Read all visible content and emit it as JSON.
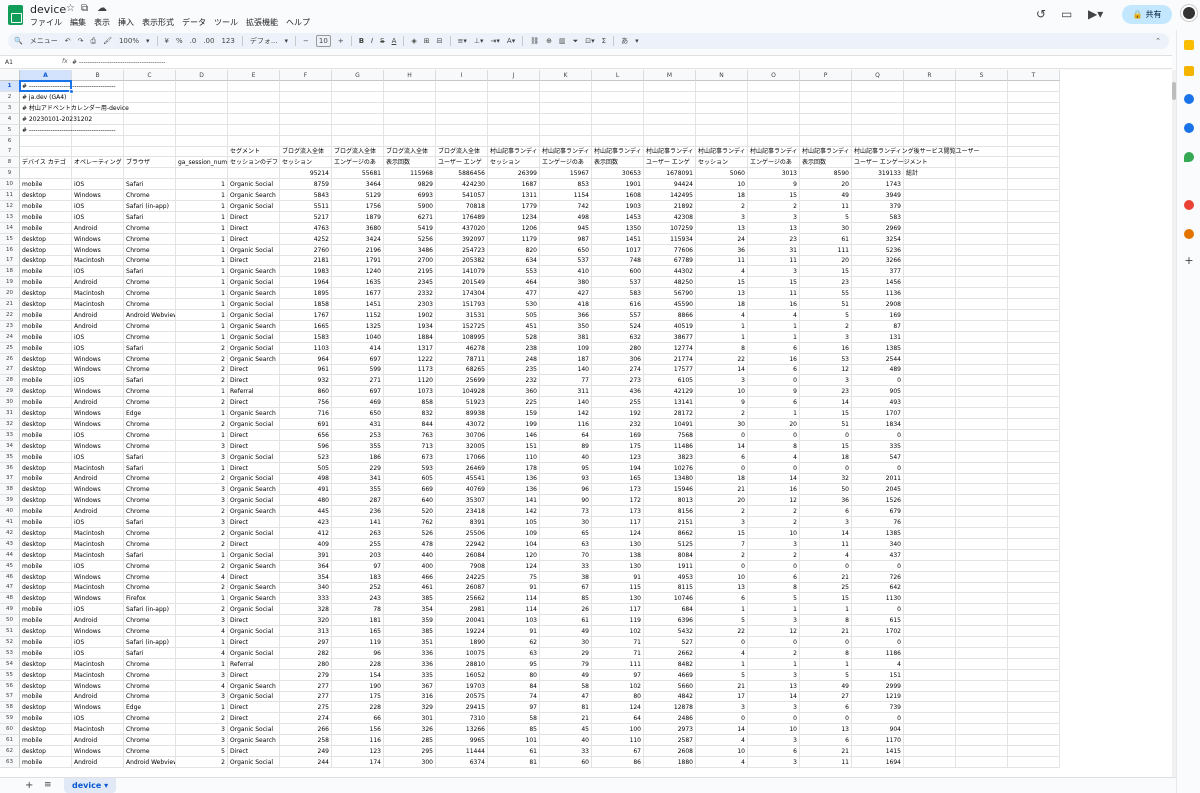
{
  "app": {
    "title": "device",
    "menu": [
      "ファイル",
      "編集",
      "表示",
      "挿入",
      "表示形式",
      "データ",
      "ツール",
      "拡張機能",
      "ヘルプ"
    ],
    "share_label": "共有",
    "icons": {
      "star": "star-icon",
      "folder": "move-to-folder-icon",
      "cloud": "cloud-status-icon",
      "history": "version-history-icon",
      "comment": "comment-icon",
      "meet": "video-call-icon",
      "lock": "lock-icon"
    }
  },
  "toolbar": {
    "menu_search": "メニュー",
    "zoom": "100%",
    "currency": "¥",
    "percent": "%",
    "dec_decrease": ".0",
    "dec_increase": ".00",
    "format_123": "123",
    "font": "デフォ...",
    "font_size": "10",
    "bold": "B",
    "italic": "I",
    "strike": "S",
    "text_color": "A",
    "sum": "Σ",
    "input_tools": "あ"
  },
  "formula_bar": {
    "name_box": "A1",
    "fx": "fx",
    "content": "# ----------------------------------------"
  },
  "columns": [
    "A",
    "B",
    "C",
    "D",
    "E",
    "F",
    "G",
    "H",
    "I",
    "J",
    "K",
    "L",
    "M",
    "N",
    "O",
    "P",
    "Q",
    "R",
    "S",
    "T"
  ],
  "header_rows": [
    {
      "row": 1,
      "A": "# ----------------------------------------"
    },
    {
      "row": 2,
      "A": "# ja.dev (GA4)"
    },
    {
      "row": 3,
      "A": "# 村山アドベントカレンダー用-device"
    },
    {
      "row": 4,
      "A": "# 20230101-20231202"
    },
    {
      "row": 5,
      "A": "# ----------------------------------------"
    },
    {
      "row": 6
    },
    {
      "row": 7,
      "E": "セグメント",
      "F": "ブログ流入全体",
      "G": "ブログ流入全体",
      "H": "ブログ流入全体",
      "I": "ブログ流入全体",
      "J": "村山記事ランディ",
      "K": "村山記事ランディ",
      "L": "村山記事ランディ",
      "M": "村山記事ランディ",
      "N": "村山記事ランディ",
      "O": "村山記事ランディ",
      "P": "村山記事ランディ",
      "Q": "村山記事ランディング後サービス閲覧ユーザー"
    },
    {
      "row": 8,
      "A": "デバイス カテゴ",
      "B": "オペレーティング",
      "C": "ブラウザ",
      "D": "ga_session_num",
      "E": "セッションのデフ",
      "F": "セッション",
      "G": "エンゲージのあ",
      "H": "表示回数",
      "I": "ユーザー エンゲ",
      "J": "セッション",
      "K": "エンゲージのあ",
      "L": "表示回数",
      "M": "ユーザー エンゲ",
      "N": "セッション",
      "O": "エンゲージのあ",
      "P": "表示回数",
      "Q": "ユーザー エンゲージメント"
    },
    {
      "row": 9,
      "F": "95214",
      "G": "55681",
      "H": "115968",
      "I": "5886456",
      "J": "26399",
      "K": "15967",
      "L": "30653",
      "M": "1678091",
      "N": "5060",
      "O": "3013",
      "P": "8590",
      "Q": "319133",
      "R": "総計"
    }
  ],
  "data_rows": [
    [
      "mobile",
      "iOS",
      "Safari",
      "1",
      "Organic Social",
      "8759",
      "3464",
      "9829",
      "424230",
      "1687",
      "853",
      "1901",
      "94424",
      "10",
      "9",
      "20",
      "1743"
    ],
    [
      "desktop",
      "Windows",
      "Chrome",
      "1",
      "Organic Search",
      "5843",
      "5129",
      "6993",
      "541057",
      "1311",
      "1154",
      "1608",
      "142495",
      "18",
      "15",
      "49",
      "3949"
    ],
    [
      "mobile",
      "iOS",
      "Safari (in-app)",
      "1",
      "Organic Social",
      "5511",
      "1756",
      "5900",
      "70818",
      "1779",
      "742",
      "1903",
      "21892",
      "2",
      "2",
      "11",
      "379"
    ],
    [
      "mobile",
      "iOS",
      "Safari",
      "1",
      "Direct",
      "5217",
      "1879",
      "6271",
      "176489",
      "1234",
      "498",
      "1453",
      "42308",
      "3",
      "3",
      "5",
      "583"
    ],
    [
      "mobile",
      "Android",
      "Chrome",
      "1",
      "Direct",
      "4763",
      "3680",
      "5419",
      "437020",
      "1206",
      "945",
      "1350",
      "107259",
      "13",
      "13",
      "30",
      "2969"
    ],
    [
      "desktop",
      "Windows",
      "Chrome",
      "1",
      "Direct",
      "4252",
      "3424",
      "5256",
      "392097",
      "1179",
      "987",
      "1451",
      "115934",
      "24",
      "23",
      "61",
      "3254"
    ],
    [
      "desktop",
      "Windows",
      "Chrome",
      "1",
      "Organic Social",
      "2760",
      "2196",
      "3486",
      "254723",
      "820",
      "650",
      "1017",
      "77606",
      "36",
      "31",
      "111",
      "5236"
    ],
    [
      "desktop",
      "Macintosh",
      "Chrome",
      "1",
      "Direct",
      "2181",
      "1791",
      "2700",
      "205382",
      "634",
      "537",
      "748",
      "67789",
      "11",
      "11",
      "20",
      "3266"
    ],
    [
      "mobile",
      "iOS",
      "Safari",
      "1",
      "Organic Search",
      "1983",
      "1240",
      "2195",
      "141079",
      "553",
      "410",
      "600",
      "44302",
      "4",
      "3",
      "15",
      "377"
    ],
    [
      "mobile",
      "Android",
      "Chrome",
      "1",
      "Organic Social",
      "1964",
      "1635",
      "2345",
      "201549",
      "464",
      "380",
      "537",
      "48250",
      "15",
      "15",
      "23",
      "1456"
    ],
    [
      "desktop",
      "Macintosh",
      "Chrome",
      "1",
      "Organic Search",
      "1895",
      "1677",
      "2332",
      "174304",
      "477",
      "427",
      "583",
      "56790",
      "13",
      "11",
      "55",
      "1136"
    ],
    [
      "desktop",
      "Macintosh",
      "Chrome",
      "1",
      "Organic Social",
      "1858",
      "1451",
      "2303",
      "151793",
      "530",
      "418",
      "616",
      "45590",
      "18",
      "16",
      "51",
      "2908"
    ],
    [
      "mobile",
      "Android",
      "Android Webview",
      "1",
      "Organic Social",
      "1767",
      "1152",
      "1902",
      "31531",
      "505",
      "366",
      "557",
      "8866",
      "4",
      "4",
      "5",
      "169"
    ],
    [
      "mobile",
      "Android",
      "Chrome",
      "1",
      "Organic Search",
      "1665",
      "1325",
      "1934",
      "152725",
      "451",
      "350",
      "524",
      "40519",
      "1",
      "1",
      "2",
      "87"
    ],
    [
      "mobile",
      "iOS",
      "Chrome",
      "1",
      "Organic Social",
      "1583",
      "1040",
      "1884",
      "108995",
      "528",
      "381",
      "632",
      "38677",
      "1",
      "1",
      "3",
      "131"
    ],
    [
      "mobile",
      "iOS",
      "Safari",
      "2",
      "Organic Social",
      "1103",
      "414",
      "1317",
      "46278",
      "238",
      "109",
      "280",
      "12774",
      "8",
      "6",
      "16",
      "1385"
    ],
    [
      "desktop",
      "Windows",
      "Chrome",
      "2",
      "Organic Search",
      "964",
      "697",
      "1222",
      "78711",
      "248",
      "187",
      "306",
      "21774",
      "22",
      "16",
      "53",
      "2544"
    ],
    [
      "desktop",
      "Windows",
      "Chrome",
      "2",
      "Direct",
      "961",
      "599",
      "1173",
      "68265",
      "235",
      "140",
      "274",
      "17577",
      "14",
      "6",
      "12",
      "489"
    ],
    [
      "mobile",
      "iOS",
      "Safari",
      "2",
      "Direct",
      "932",
      "271",
      "1120",
      "25699",
      "232",
      "77",
      "273",
      "6105",
      "3",
      "0",
      "3",
      "0"
    ],
    [
      "desktop",
      "Windows",
      "Chrome",
      "1",
      "Referral",
      "860",
      "697",
      "1073",
      "104928",
      "360",
      "311",
      "436",
      "42129",
      "10",
      "9",
      "23",
      "905"
    ],
    [
      "mobile",
      "Android",
      "Chrome",
      "2",
      "Direct",
      "756",
      "469",
      "858",
      "51923",
      "225",
      "140",
      "255",
      "13141",
      "9",
      "6",
      "14",
      "493"
    ],
    [
      "desktop",
      "Windows",
      "Edge",
      "1",
      "Organic Search",
      "716",
      "650",
      "832",
      "89938",
      "159",
      "142",
      "192",
      "28172",
      "2",
      "1",
      "15",
      "1707"
    ],
    [
      "desktop",
      "Windows",
      "Chrome",
      "2",
      "Organic Social",
      "691",
      "431",
      "844",
      "43072",
      "199",
      "116",
      "232",
      "10491",
      "30",
      "20",
      "51",
      "1834"
    ],
    [
      "mobile",
      "iOS",
      "Chrome",
      "1",
      "Direct",
      "656",
      "253",
      "763",
      "30706",
      "146",
      "64",
      "169",
      "7568",
      "0",
      "0",
      "0",
      "0"
    ],
    [
      "desktop",
      "Windows",
      "Chrome",
      "3",
      "Direct",
      "596",
      "355",
      "713",
      "32005",
      "151",
      "89",
      "175",
      "11486",
      "14",
      "8",
      "15",
      "335"
    ],
    [
      "mobile",
      "iOS",
      "Safari",
      "3",
      "Organic Social",
      "523",
      "186",
      "673",
      "17066",
      "110",
      "40",
      "123",
      "3823",
      "6",
      "4",
      "18",
      "547"
    ],
    [
      "desktop",
      "Macintosh",
      "Safari",
      "1",
      "Direct",
      "505",
      "229",
      "593",
      "26469",
      "178",
      "95",
      "194",
      "10276",
      "0",
      "0",
      "0",
      "0"
    ],
    [
      "mobile",
      "Android",
      "Chrome",
      "2",
      "Organic Social",
      "498",
      "341",
      "605",
      "45541",
      "136",
      "93",
      "165",
      "13480",
      "18",
      "14",
      "32",
      "2011"
    ],
    [
      "desktop",
      "Windows",
      "Chrome",
      "3",
      "Organic Search",
      "491",
      "355",
      "669",
      "40769",
      "136",
      "96",
      "173",
      "15946",
      "21",
      "16",
      "50",
      "2045"
    ],
    [
      "desktop",
      "Windows",
      "Chrome",
      "3",
      "Organic Social",
      "480",
      "287",
      "640",
      "35307",
      "141",
      "90",
      "172",
      "8013",
      "20",
      "12",
      "36",
      "1526"
    ],
    [
      "mobile",
      "Android",
      "Chrome",
      "2",
      "Organic Search",
      "445",
      "236",
      "520",
      "23418",
      "142",
      "73",
      "173",
      "8156",
      "2",
      "2",
      "6",
      "679"
    ],
    [
      "mobile",
      "iOS",
      "Safari",
      "3",
      "Direct",
      "423",
      "141",
      "762",
      "8391",
      "105",
      "30",
      "117",
      "2151",
      "3",
      "2",
      "3",
      "76"
    ],
    [
      "desktop",
      "Macintosh",
      "Chrome",
      "2",
      "Organic Social",
      "412",
      "263",
      "526",
      "25506",
      "109",
      "65",
      "124",
      "8662",
      "15",
      "10",
      "14",
      "1385"
    ],
    [
      "desktop",
      "Macintosh",
      "Chrome",
      "2",
      "Direct",
      "409",
      "255",
      "478",
      "22942",
      "104",
      "63",
      "130",
      "5125",
      "7",
      "3",
      "11",
      "340"
    ],
    [
      "desktop",
      "Macintosh",
      "Safari",
      "1",
      "Organic Social",
      "391",
      "203",
      "440",
      "26084",
      "120",
      "70",
      "138",
      "8084",
      "2",
      "2",
      "4",
      "437"
    ],
    [
      "mobile",
      "iOS",
      "Chrome",
      "2",
      "Organic Search",
      "364",
      "97",
      "400",
      "7908",
      "124",
      "33",
      "130",
      "1911",
      "0",
      "0",
      "0",
      "0"
    ],
    [
      "desktop",
      "Windows",
      "Chrome",
      "4",
      "Direct",
      "354",
      "183",
      "466",
      "24225",
      "75",
      "38",
      "91",
      "4953",
      "10",
      "6",
      "21",
      "726"
    ],
    [
      "desktop",
      "Macintosh",
      "Chrome",
      "2",
      "Organic Search",
      "340",
      "252",
      "461",
      "26087",
      "91",
      "67",
      "115",
      "8115",
      "13",
      "8",
      "25",
      "642"
    ],
    [
      "desktop",
      "Windows",
      "Firefox",
      "1",
      "Organic Search",
      "333",
      "243",
      "385",
      "25662",
      "114",
      "85",
      "130",
      "10746",
      "6",
      "5",
      "15",
      "1130"
    ],
    [
      "mobile",
      "iOS",
      "Safari (in-app)",
      "2",
      "Organic Social",
      "328",
      "78",
      "354",
      "2981",
      "114",
      "26",
      "117",
      "684",
      "1",
      "1",
      "1",
      "0"
    ],
    [
      "mobile",
      "Android",
      "Chrome",
      "3",
      "Direct",
      "320",
      "181",
      "359",
      "20041",
      "103",
      "61",
      "119",
      "6396",
      "5",
      "3",
      "8",
      "615"
    ],
    [
      "desktop",
      "Windows",
      "Chrome",
      "4",
      "Organic Social",
      "313",
      "165",
      "385",
      "19224",
      "91",
      "49",
      "102",
      "5432",
      "22",
      "12",
      "21",
      "1702"
    ],
    [
      "mobile",
      "iOS",
      "Safari (in-app)",
      "1",
      "Direct",
      "297",
      "119",
      "351",
      "1890",
      "62",
      "30",
      "71",
      "527",
      "0",
      "0",
      "0",
      "0"
    ],
    [
      "mobile",
      "iOS",
      "Safari",
      "4",
      "Organic Social",
      "282",
      "96",
      "336",
      "10075",
      "63",
      "29",
      "71",
      "2662",
      "4",
      "2",
      "8",
      "1186"
    ],
    [
      "desktop",
      "Macintosh",
      "Chrome",
      "1",
      "Referral",
      "280",
      "228",
      "336",
      "28810",
      "95",
      "79",
      "111",
      "8482",
      "1",
      "1",
      "1",
      "4"
    ],
    [
      "desktop",
      "Macintosh",
      "Chrome",
      "3",
      "Direct",
      "279",
      "154",
      "335",
      "16052",
      "80",
      "49",
      "97",
      "4669",
      "5",
      "3",
      "5",
      "151"
    ],
    [
      "desktop",
      "Windows",
      "Chrome",
      "4",
      "Organic Search",
      "277",
      "190",
      "367",
      "19703",
      "84",
      "58",
      "102",
      "5660",
      "21",
      "13",
      "49",
      "2999"
    ],
    [
      "mobile",
      "Android",
      "Chrome",
      "3",
      "Organic Social",
      "277",
      "175",
      "316",
      "20575",
      "74",
      "47",
      "80",
      "4842",
      "17",
      "14",
      "27",
      "1219"
    ],
    [
      "desktop",
      "Windows",
      "Edge",
      "1",
      "Direct",
      "275",
      "228",
      "329",
      "29415",
      "97",
      "81",
      "124",
      "12878",
      "3",
      "3",
      "6",
      "739"
    ],
    [
      "mobile",
      "iOS",
      "Chrome",
      "2",
      "Direct",
      "274",
      "66",
      "301",
      "7310",
      "58",
      "21",
      "64",
      "2486",
      "0",
      "0",
      "0",
      "0"
    ],
    [
      "desktop",
      "Macintosh",
      "Chrome",
      "3",
      "Organic Social",
      "266",
      "156",
      "326",
      "13266",
      "85",
      "45",
      "100",
      "2973",
      "14",
      "10",
      "13",
      "904"
    ],
    [
      "mobile",
      "Android",
      "Chrome",
      "3",
      "Organic Search",
      "258",
      "116",
      "285",
      "9965",
      "101",
      "40",
      "110",
      "2587",
      "4",
      "3",
      "6",
      "1170"
    ],
    [
      "desktop",
      "Windows",
      "Chrome",
      "5",
      "Direct",
      "249",
      "123",
      "295",
      "11444",
      "61",
      "33",
      "67",
      "2608",
      "10",
      "6",
      "21",
      "1415"
    ],
    [
      "mobile",
      "Android",
      "Android Webview",
      "2",
      "Organic Social",
      "244",
      "174",
      "300",
      "6374",
      "81",
      "60",
      "86",
      "1880",
      "4",
      "3",
      "11",
      "1694"
    ]
  ],
  "sheet_tabs": [
    {
      "label": "device",
      "active": true
    }
  ]
}
